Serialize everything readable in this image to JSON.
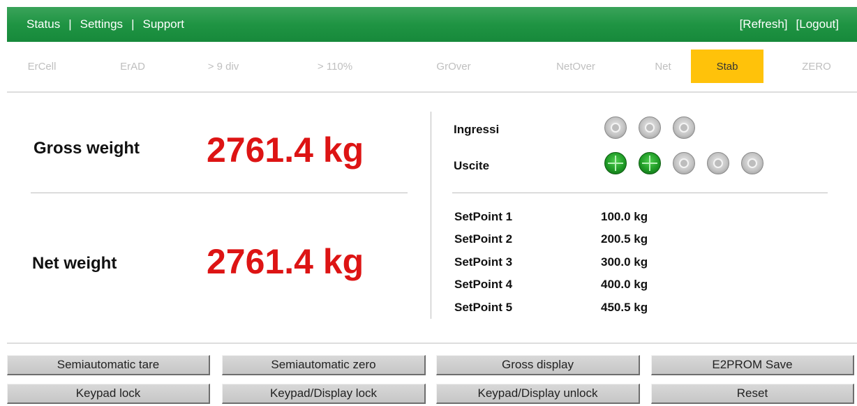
{
  "nav": {
    "links": [
      "Status",
      "Settings",
      "Support"
    ],
    "separator": "|",
    "actions": [
      "[Refresh]",
      "[Logout]"
    ]
  },
  "flags": [
    {
      "label": "ErCell",
      "active": false
    },
    {
      "label": "ErAD",
      "active": false
    },
    {
      "label": "> 9 div",
      "active": false
    },
    {
      "label": "> 110%",
      "active": false
    },
    {
      "label": "GrOver",
      "active": false
    },
    {
      "label": "NetOver",
      "active": false
    },
    {
      "label": "Net",
      "active": false
    },
    {
      "label": "Stab",
      "active": true
    },
    {
      "label": "ZERO",
      "active": false
    }
  ],
  "weights": {
    "gross_label": "Gross weight",
    "gross_value": "2761.4 kg",
    "net_label": "Net weight",
    "net_value": "2761.4 kg"
  },
  "io": {
    "inputs_label": "Ingressi",
    "inputs": [
      false,
      false,
      false
    ],
    "outputs_label": "Uscite",
    "outputs": [
      true,
      true,
      false,
      false,
      false
    ]
  },
  "setpoints": [
    {
      "name": "SetPoint 1",
      "value": "100.0 kg"
    },
    {
      "name": "SetPoint 2",
      "value": "200.5 kg"
    },
    {
      "name": "SetPoint 3",
      "value": "300.0 kg"
    },
    {
      "name": "SetPoint 4",
      "value": "400.0 kg"
    },
    {
      "name": "SetPoint 5",
      "value": "450.5 kg"
    }
  ],
  "buttons": [
    "Semiautomatic tare",
    "Semiautomatic zero",
    "Gross display",
    "E2PROM Save",
    "Keypad lock",
    "Keypad/Display lock",
    "Keypad/Display unlock",
    "Reset"
  ],
  "colors": {
    "header_green": "#1f9443",
    "active_flag": "#ffc20a",
    "weight_red": "#dd1414",
    "led_on": "#1f9a26",
    "led_off": "#c4c4c4"
  }
}
